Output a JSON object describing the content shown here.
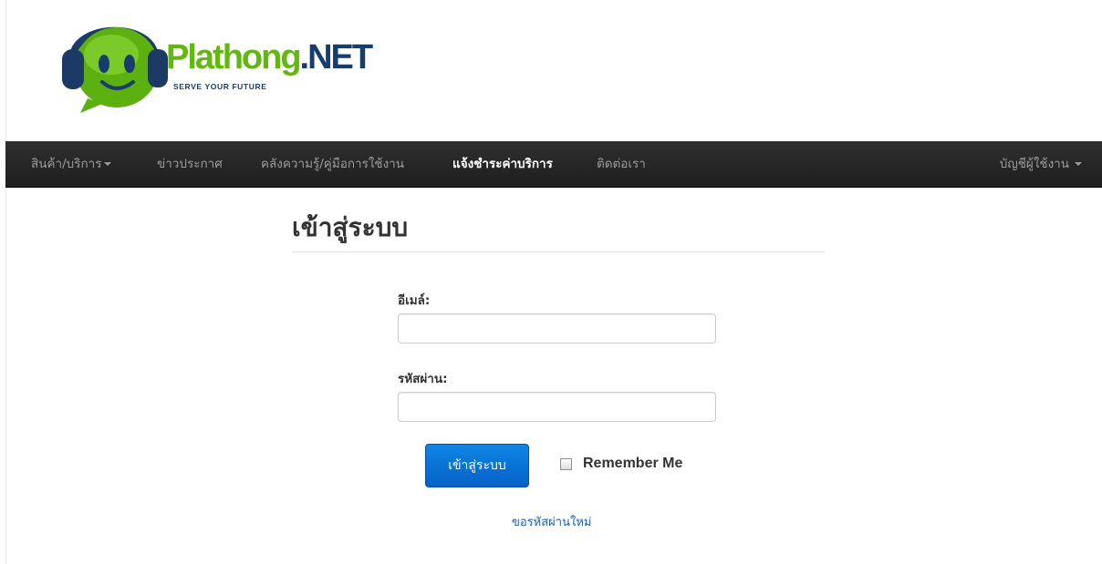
{
  "brand": {
    "name_part1": "Plathong",
    "name_part2": ".NET",
    "tagline": "SERVE YOUR FUTURE",
    "color_green": "#63b80f",
    "color_blue": "#173d6e"
  },
  "nav": {
    "items": [
      {
        "label": "สินค้า/บริการ",
        "dropdown": true
      },
      {
        "label": "ข่าวประกาศ"
      },
      {
        "label": "คลังความรู้/คู่มือการใช้งาน"
      },
      {
        "label": "แจ้งชำระค่าบริการ",
        "active": true
      },
      {
        "label": "ติดต่อเรา"
      }
    ],
    "account": {
      "label": "บัญชีผู้ใช้งาน",
      "dropdown": true
    }
  },
  "page": {
    "title": "เข้าสู่ระบบ"
  },
  "form": {
    "email_label": "อีเมล์:",
    "email_value": "",
    "password_label": "รหัสผ่าน:",
    "password_value": "",
    "submit_label": "เข้าสู่ระบบ",
    "remember_label": "Remember Me",
    "remember_checked": false,
    "forgot_link": "ขอรหัสผ่านใหม่"
  },
  "colors": {
    "navbar_bg": "#222222",
    "primary_button": "#0a74da",
    "link": "#1a5fb4"
  }
}
